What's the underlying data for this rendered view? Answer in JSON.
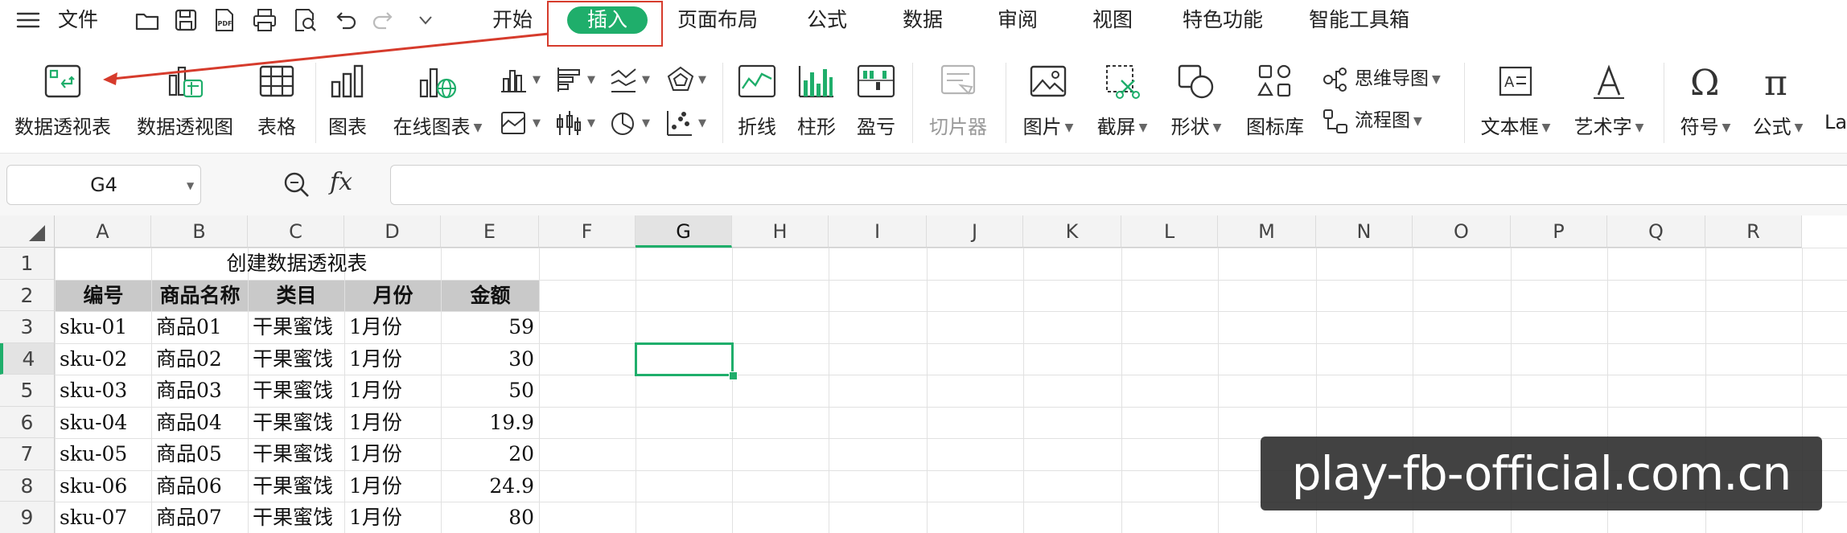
{
  "menubar": {
    "file_label": "文件",
    "tabs": [
      "开始",
      "插入",
      "页面布局",
      "公式",
      "数据",
      "审阅",
      "视图",
      "特色功能",
      "智能工具箱"
    ],
    "active_tab": "插入"
  },
  "ribbon": {
    "pivot_table": "数据透视表",
    "pivot_chart": "数据透视图",
    "table": "表格",
    "chart": "图表",
    "online_chart": "在线图表",
    "sparkline_line": "折线",
    "sparkline_column": "柱形",
    "sparkline_winloss": "盈亏",
    "slicer": "切片器",
    "picture": "图片",
    "screenshot": "截屏",
    "shapes": "形状",
    "icon_library": "图标库",
    "mind_map": "思维导图",
    "flowchart": "流程图",
    "textbox": "文本框",
    "wordart": "艺术字",
    "symbol": "符号",
    "formula": "公式",
    "latex_partial": "La"
  },
  "formula_bar": {
    "name_box": "G4",
    "fx_label": "fx",
    "value": ""
  },
  "sheet": {
    "columns": [
      "A",
      "B",
      "C",
      "D",
      "E",
      "F",
      "G",
      "H",
      "I",
      "J",
      "K",
      "L",
      "M",
      "N",
      "O",
      "P",
      "Q",
      "R"
    ],
    "rows": [
      "1",
      "2",
      "3",
      "4",
      "5",
      "6",
      "7",
      "8",
      "9"
    ],
    "active_column": "G",
    "active_row": "4",
    "title": "创建数据透视表",
    "headers": [
      "编号",
      "商品名称",
      "类目",
      "月份",
      "金额"
    ],
    "records": [
      [
        "sku-01",
        "商品01",
        "干果蜜饯",
        "1月份",
        "59"
      ],
      [
        "sku-02",
        "商品02",
        "干果蜜饯",
        "1月份",
        "30"
      ],
      [
        "sku-03",
        "商品03",
        "干果蜜饯",
        "1月份",
        "50"
      ],
      [
        "sku-04",
        "商品04",
        "干果蜜饯",
        "1月份",
        "19.9"
      ],
      [
        "sku-05",
        "商品05",
        "干果蜜饯",
        "1月份",
        "20"
      ],
      [
        "sku-06",
        "商品06",
        "干果蜜饯",
        "1月份",
        "24.9"
      ],
      [
        "sku-07",
        "商品07",
        "干果蜜饯",
        "1月份",
        "80"
      ]
    ]
  },
  "watermark": {
    "text": "play-fb-official.com.cn"
  },
  "colors": {
    "accent": "#1fae6b",
    "annotation": "#d63b2c",
    "header_fill": "#c9c9c9"
  }
}
